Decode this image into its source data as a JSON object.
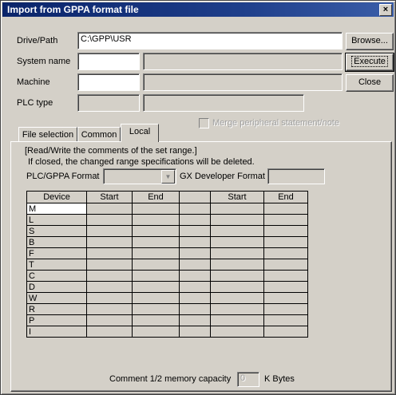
{
  "window": {
    "title": "Import from GPPA format file",
    "close_glyph": "×"
  },
  "fields": {
    "drive_path": {
      "label": "Drive/Path",
      "value": "C:\\GPP\\USR"
    },
    "system_name": {
      "label": "System name"
    },
    "machine": {
      "label": "Machine"
    },
    "plc_type": {
      "label": "PLC type"
    }
  },
  "buttons": {
    "browse": "Browse...",
    "execute": "Execute",
    "close": "Close"
  },
  "tabs": [
    {
      "label": "File selection"
    },
    {
      "label": "Common"
    },
    {
      "label": "Local",
      "active": true
    }
  ],
  "merge_checkbox": {
    "label": "Merge peripheral statement/note",
    "checked": false,
    "enabled": false
  },
  "panel": {
    "info_line1": "[Read/Write the comments of the set range.]",
    "info_line2": "If closed, the changed range specifications will be deleted.",
    "plc_format_label": "PLC/GPPA Format",
    "gx_format_label": "GX Developer Format"
  },
  "table": {
    "headers": [
      "Device",
      "Start",
      "End",
      "",
      "Start",
      "End"
    ],
    "devices": [
      "M",
      "L",
      "S",
      "B",
      "F",
      "T",
      "C",
      "D",
      "W",
      "R",
      "P",
      "I"
    ]
  },
  "footer": {
    "label": "Comment 1/2 memory capacity",
    "value": "0",
    "unit": "K Bytes"
  }
}
